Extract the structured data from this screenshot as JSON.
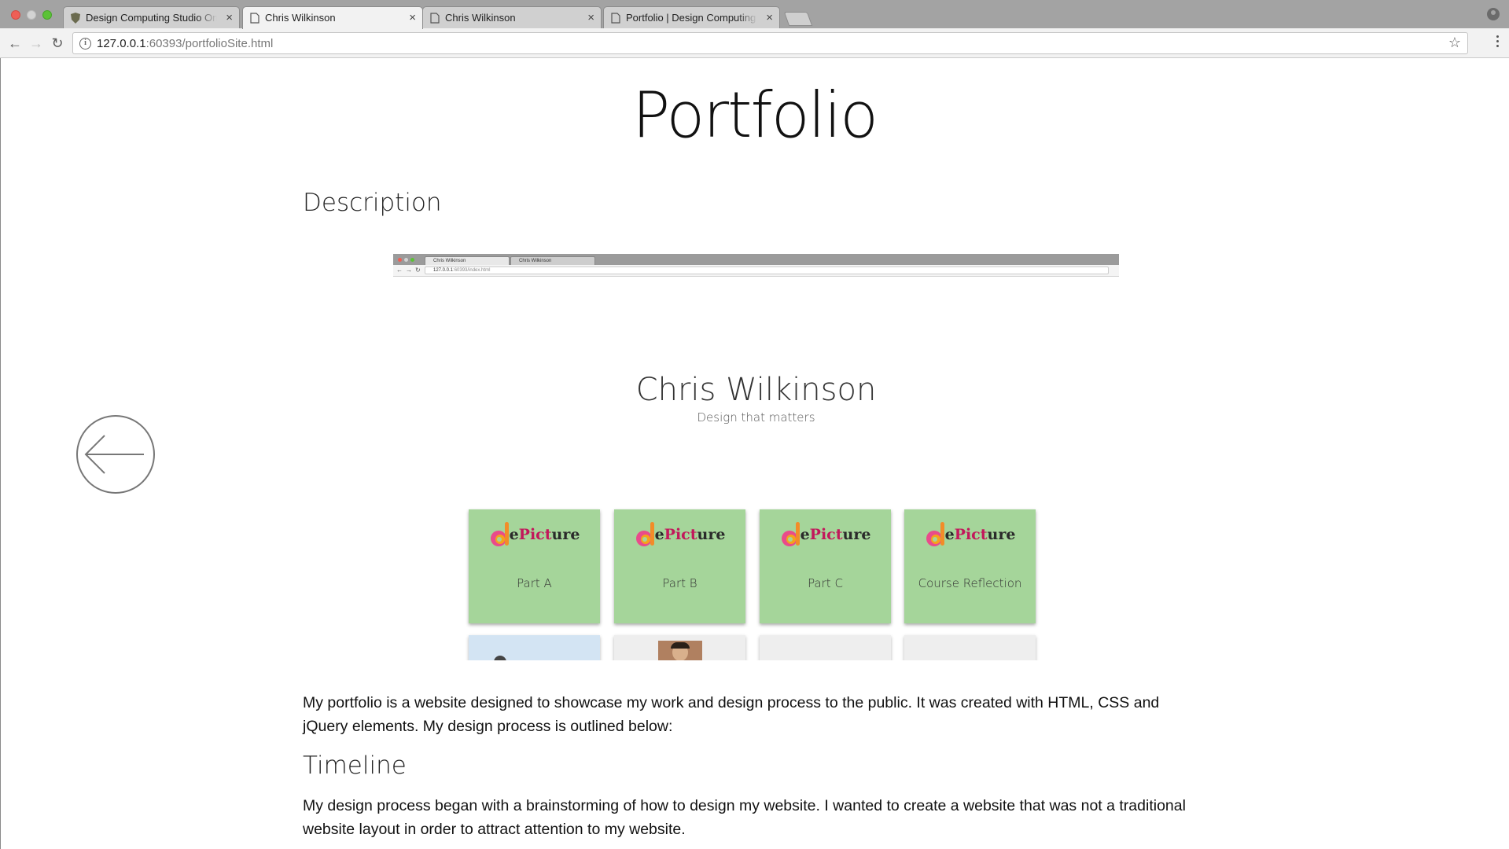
{
  "browser": {
    "tabs": [
      {
        "title": "Design Computing Studio One"
      },
      {
        "title": "Chris Wilkinson"
      },
      {
        "title": "Chris Wilkinson"
      },
      {
        "title": "Portfolio | Design Computing S"
      }
    ],
    "url_host": "127.0.0.1",
    "url_rest": ":60393/portfolioSite.html"
  },
  "page": {
    "title": "Portfolio",
    "description_heading": "Description",
    "timeline_heading": "Timeline",
    "paragraph1": "My portfolio is a website designed to showcase my work and design process to the public. It was created with HTML, CSS and jQuery elements. My design process is outlined below:",
    "paragraph2": "My design process began with a brainstorming of how to design my website. I wanted to create a website that was not a traditional website layout in order to attract attention to my website."
  },
  "embed": {
    "tabs": [
      {
        "title": "Chris Wilkinson"
      },
      {
        "title": "Chris Wilkinson"
      }
    ],
    "url_host": "127.0.0.1",
    "url_rest": ":60393/index.html",
    "name": "Chris Wilkinson",
    "tagline": "Design that matters",
    "logo_prefix": "e",
    "logo_pink": "Pict",
    "logo_suffix": "ure",
    "cards": [
      {
        "label": "Part A"
      },
      {
        "label": "Part B"
      },
      {
        "label": "Part C"
      },
      {
        "label": "Course Reflection"
      }
    ]
  },
  "colors": {
    "card_green": "#a5d59a",
    "card_blue": "#d3e4f3",
    "card_grey": "#eeeeee"
  }
}
